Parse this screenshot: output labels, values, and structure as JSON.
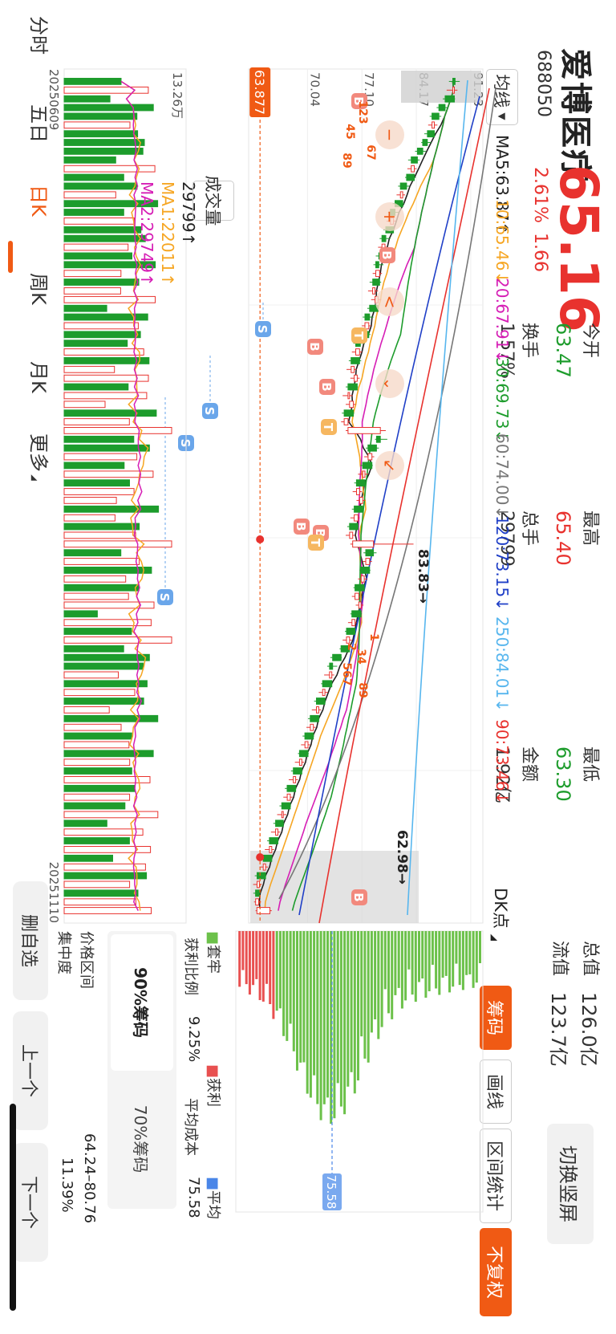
{
  "colors": {
    "up": "#e8322e",
    "down": "#1d9c2c",
    "accent": "#f05a14",
    "chip_green": "#6cc14a",
    "chip_red": "#e85050",
    "avg_blue": "#4a86e8"
  },
  "stock": {
    "name": "爱博医疗",
    "code": "688050",
    "price": "65.16",
    "pct": "2.61%",
    "chg": "1.66"
  },
  "quotes": [
    {
      "label": "今开",
      "value": "63.47",
      "color": "green"
    },
    {
      "label": "最高",
      "value": "65.40",
      "color": "red"
    },
    {
      "label": "最低",
      "value": "63.30",
      "color": "green"
    },
    {
      "label": "换手",
      "value": "1.57%",
      "color": "grey"
    },
    {
      "label": "总手",
      "value": "29799",
      "color": "grey"
    },
    {
      "label": "金额",
      "value": "1.92亿",
      "color": "grey"
    }
  ],
  "cap": {
    "total_label": "总值",
    "total_value": "126.0亿",
    "float_label": "流值",
    "float_value": "123.7亿"
  },
  "toolbar": {
    "switch_label": "切换竖屏",
    "chip_tab": "筹码",
    "draw_tab": "画线",
    "stat_tab": "区间统计",
    "norecov_tab": "不复权"
  },
  "ma_bar": {
    "selector": "均线",
    "items": [
      {
        "text": "MA5:63.87↑",
        "color": "#222222"
      },
      {
        "text": "10:65.46↓",
        "color": "#f6a623"
      },
      {
        "text": "20:67.91↓",
        "color": "#d61eb5"
      },
      {
        "text": "30:69.73↓",
        "color": "#1d9c2c"
      },
      {
        "text": "60:74.00↓",
        "color": "#777777"
      },
      {
        "text": "120:73.15↓",
        "color": "#1f3fc7"
      },
      {
        "text": "250:84.01↓",
        "color": "#57b6ee"
      },
      {
        "text": "90:73.46↓",
        "color": "#e8322e"
      }
    ],
    "dk": "DK点"
  },
  "price_axis": {
    "labels": [
      "91.23",
      "84.17",
      "77.10",
      "70.04"
    ],
    "cursor_price": "63.877"
  },
  "annotations": {
    "high": "83.83→",
    "low": "62.98→",
    "avg_cost": "75.58"
  },
  "volume": {
    "selector": "成交量",
    "value": "29799↑",
    "ma1": "MA1:22011↑",
    "ma2": "MA2:29749↑",
    "axis_max": "13.26万"
  },
  "dates": {
    "start": "20250609",
    "end": "20251110"
  },
  "chips": {
    "legend_trapped": "套牢",
    "legend_profit": "获利",
    "legend_avg": "平均",
    "profit_ratio_label": "获利比例",
    "profit_ratio": "9.25%",
    "avg_cost_label": "平均成本",
    "avg_cost": "75.58",
    "tab90": "90%筹码",
    "tab70": "70%筹码",
    "range_label": "价格区间",
    "range": "64.24–80.76",
    "concentration_label": "集中度",
    "concentration": "11.39%"
  },
  "nav": {
    "items": [
      "分时",
      "五日",
      "日K",
      "周K",
      "月K",
      "更多"
    ],
    "active": 2
  },
  "side_buttons": {
    "remove": "删自选",
    "prev": "上一个",
    "next": "下一个"
  },
  "chart_data": {
    "type": "candlestick",
    "title": "",
    "period": "日K",
    "date_range": [
      "20250609",
      "20251110"
    ],
    "ylim": [
      62.98,
      91.23
    ],
    "price_ticks": [
      91.23,
      84.17,
      77.1,
      70.04
    ],
    "high_marker": 83.83,
    "low_marker": 62.98,
    "candles": [
      [
        89.2,
        89.8,
        88.4,
        88.9
      ],
      [
        88.9,
        89.5,
        88.1,
        89.1
      ],
      [
        89.1,
        89.2,
        87.6,
        87.9
      ],
      [
        87.9,
        88.3,
        86.8,
        87.1
      ],
      [
        87.1,
        87.4,
        85.9,
        86.2
      ],
      [
        86.2,
        86.9,
        85.7,
        86.5
      ],
      [
        86.5,
        86.6,
        85.2,
        85.6
      ],
      [
        85.6,
        86.1,
        84.8,
        85.0
      ],
      [
        85.0,
        85.4,
        84.0,
        84.3
      ],
      [
        84.3,
        84.6,
        83.1,
        83.5
      ],
      [
        83.5,
        84.2,
        83.0,
        83.9
      ],
      [
        83.9,
        84.1,
        82.7,
        82.9
      ],
      [
        82.9,
        83.3,
        81.8,
        82.1
      ],
      [
        82.1,
        82.7,
        81.6,
        82.4
      ],
      [
        82.4,
        82.6,
        81.1,
        81.4
      ],
      [
        81.4,
        81.9,
        80.5,
        80.8
      ],
      [
        80.8,
        81.5,
        80.3,
        81.2
      ],
      [
        81.2,
        81.3,
        79.9,
        80.2
      ],
      [
        80.2,
        80.8,
        79.4,
        79.7
      ],
      [
        79.7,
        80.4,
        79.2,
        80.1
      ],
      [
        80.1,
        80.3,
        78.9,
        79.3
      ],
      [
        79.3,
        79.9,
        78.6,
        78.9
      ],
      [
        78.9,
        79.7,
        78.5,
        79.4
      ],
      [
        79.4,
        79.6,
        78.1,
        78.5
      ],
      [
        78.5,
        79.2,
        77.9,
        78.8
      ],
      [
        78.8,
        79.6,
        78.3,
        79.2
      ],
      [
        79.2,
        79.3,
        77.8,
        78.1
      ],
      [
        78.1,
        78.6,
        77.2,
        77.5
      ],
      [
        77.5,
        78.3,
        77.1,
        78.0
      ],
      [
        78.0,
        78.2,
        76.6,
        76.9
      ],
      [
        76.9,
        77.5,
        76.0,
        76.3
      ],
      [
        76.3,
        77.1,
        75.8,
        76.8
      ],
      [
        76.8,
        77.0,
        75.4,
        75.7
      ],
      [
        75.7,
        76.4,
        75.1,
        76.1
      ],
      [
        76.1,
        76.8,
        75.6,
        76.5
      ],
      [
        76.5,
        76.6,
        75.0,
        75.3
      ],
      [
        75.3,
        75.9,
        74.6,
        75.5
      ],
      [
        75.5,
        76.3,
        75.0,
        76.0
      ],
      [
        76.0,
        76.1,
        74.5,
        74.8
      ],
      [
        74.8,
        75.6,
        74.4,
        75.3
      ],
      [
        75.3,
        80.2,
        75.0,
        79.5
      ],
      [
        79.5,
        80.4,
        78.8,
        79.0
      ],
      [
        79.0,
        79.3,
        77.6,
        77.9
      ],
      [
        77.9,
        78.7,
        77.4,
        78.4
      ],
      [
        78.4,
        78.5,
        76.9,
        77.2
      ],
      [
        77.2,
        77.9,
        76.6,
        77.5
      ],
      [
        77.5,
        77.6,
        76.1,
        76.4
      ],
      [
        76.4,
        77.1,
        75.9,
        76.8
      ],
      [
        76.8,
        77.5,
        76.4,
        77.2
      ],
      [
        77.2,
        77.3,
        75.8,
        76.1
      ],
      [
        76.1,
        76.8,
        75.6,
        76.6
      ],
      [
        76.6,
        76.7,
        75.2,
        75.5
      ],
      [
        75.5,
        76.2,
        75.0,
        75.9
      ],
      [
        75.9,
        83.8,
        75.6,
        78.6
      ],
      [
        78.6,
        79.0,
        77.3,
        77.6
      ],
      [
        77.6,
        78.4,
        77.2,
        78.1
      ],
      [
        78.1,
        78.2,
        76.8,
        77.0
      ],
      [
        77.0,
        77.8,
        76.6,
        77.4
      ],
      [
        77.4,
        77.5,
        76.0,
        76.2
      ],
      [
        76.2,
        76.9,
        75.8,
        76.7
      ],
      [
        76.7,
        77.3,
        76.3,
        77.0
      ],
      [
        77.0,
        77.1,
        75.6,
        75.8
      ],
      [
        75.8,
        76.4,
        75.3,
        76.2
      ],
      [
        76.2,
        76.3,
        74.9,
        75.1
      ],
      [
        75.1,
        75.8,
        74.6,
        75.5
      ],
      [
        75.5,
        75.6,
        74.2,
        74.4
      ],
      [
        74.4,
        74.5,
        73.0,
        73.3
      ],
      [
        73.3,
        73.9,
        72.6,
        72.9
      ],
      [
        72.9,
        73.5,
        72.2,
        73.2
      ],
      [
        73.2,
        73.3,
        71.8,
        72.0
      ],
      [
        72.0,
        72.7,
        71.5,
        72.3
      ],
      [
        72.3,
        72.4,
        70.9,
        71.2
      ],
      [
        71.2,
        71.8,
        70.6,
        71.5
      ],
      [
        71.5,
        71.6,
        70.1,
        70.4
      ],
      [
        70.4,
        71.1,
        69.9,
        70.8
      ],
      [
        70.8,
        70.9,
        69.4,
        69.7
      ],
      [
        69.7,
        70.4,
        69.2,
        70.1
      ],
      [
        70.1,
        70.2,
        68.8,
        69.0
      ],
      [
        69.0,
        69.6,
        68.4,
        69.3
      ],
      [
        69.3,
        69.4,
        67.9,
        68.2
      ],
      [
        68.2,
        68.8,
        67.6,
        68.5
      ],
      [
        68.5,
        68.6,
        67.1,
        67.4
      ],
      [
        67.4,
        68.1,
        66.9,
        67.8
      ],
      [
        67.8,
        67.9,
        66.4,
        66.7
      ],
      [
        66.7,
        67.3,
        66.1,
        66.9
      ],
      [
        66.9,
        67.0,
        65.6,
        65.9
      ],
      [
        65.9,
        66.5,
        65.3,
        66.2
      ],
      [
        66.2,
        66.3,
        64.8,
        65.1
      ],
      [
        65.1,
        65.7,
        64.5,
        65.4
      ],
      [
        65.4,
        65.5,
        64.1,
        64.3
      ],
      [
        64.3,
        64.9,
        63.8,
        64.6
      ],
      [
        64.6,
        64.7,
        63.2,
        63.5
      ],
      [
        63.5,
        64.1,
        62.98,
        63.8
      ],
      [
        63.8,
        63.9,
        63.0,
        63.3
      ],
      [
        63.3,
        64.0,
        63.1,
        63.7
      ],
      [
        63.47,
        65.4,
        63.3,
        65.16
      ]
    ]
  }
}
